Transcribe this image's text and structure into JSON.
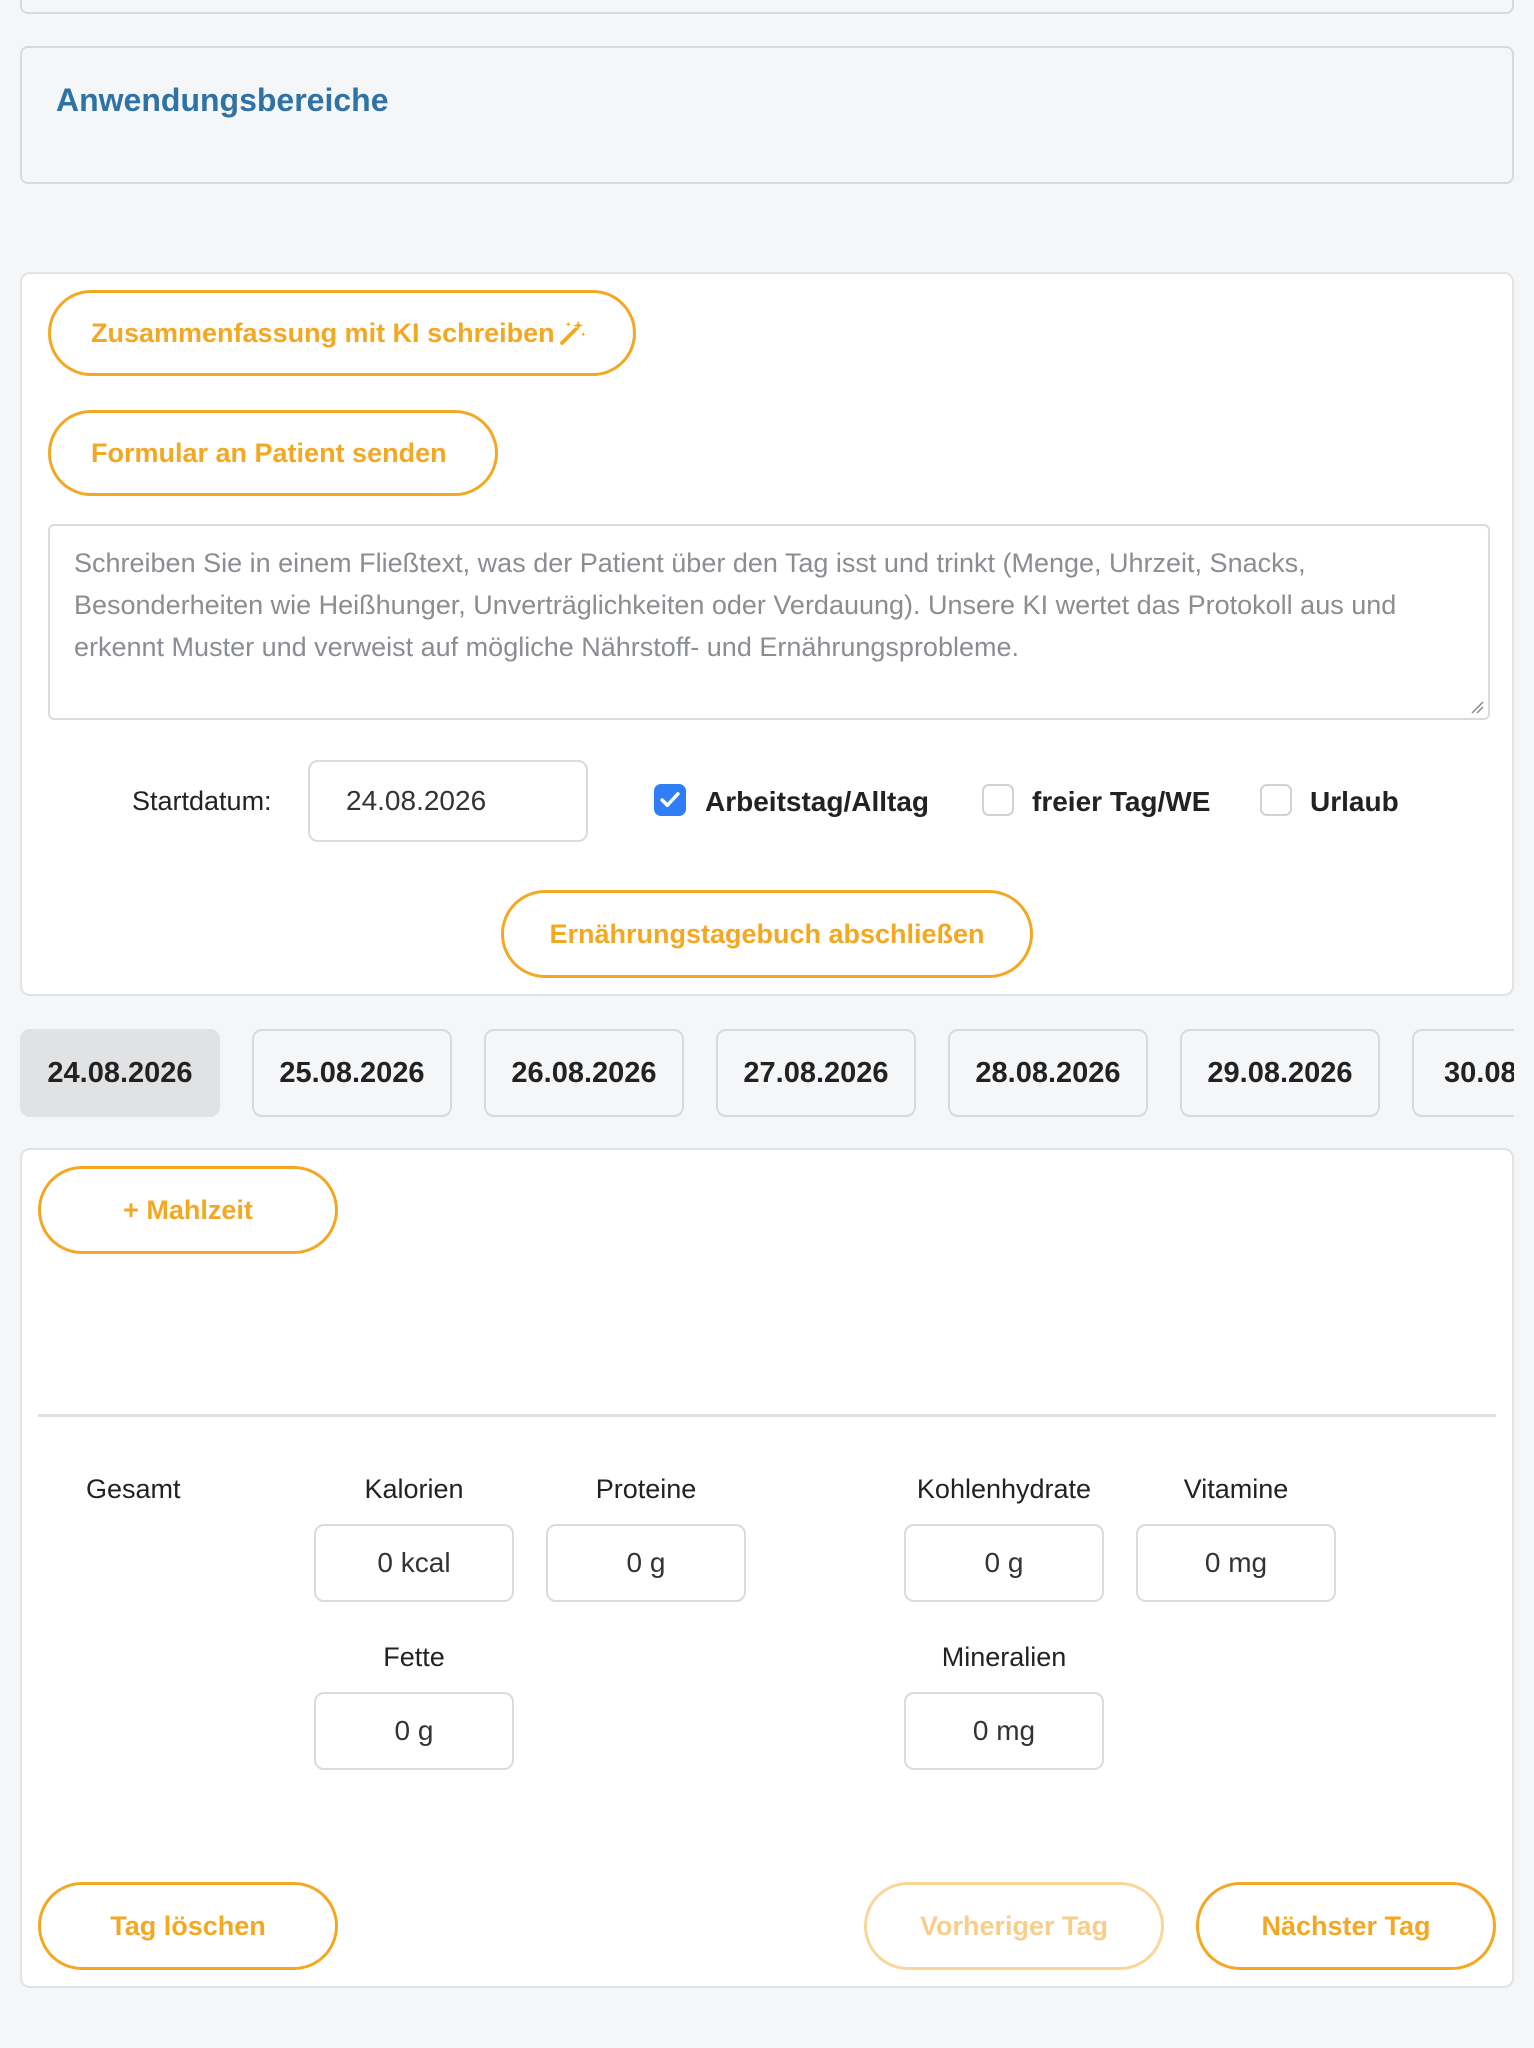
{
  "section": {
    "title": "Anwendungsbereiche"
  },
  "ai_card": {
    "summary_button": "Zusammenfassung mit KI schreiben",
    "send_form_button": "Formular an Patient senden",
    "protocol_placeholder": "Schreiben Sie in einem Fließtext, was der Patient über den Tag isst und trinkt (Menge, Uhrzeit, Snacks, Besonderheiten wie Heißhunger, Unverträglichkeiten oder Verdauung). Unsere KI wertet das Protokoll aus und erkennt Muster und verweist auf mögliche Nährstoff- und Ernährungsprobleme.",
    "start_label": "Startdatum:",
    "start_date": "24.08.2026",
    "day_types": [
      {
        "label": "Arbeitstag/Alltag",
        "checked": true
      },
      {
        "label": "freier Tag/WE",
        "checked": false
      },
      {
        "label": "Urlaub",
        "checked": false
      }
    ],
    "finish_button": "Ernährungstagebuch abschließen"
  },
  "date_tabs": [
    "24.08.2026",
    "25.08.2026",
    "26.08.2026",
    "27.08.2026",
    "28.08.2026",
    "29.08.2026",
    "30.08"
  ],
  "day_card": {
    "add_meal_button": "+ Mahlzeit",
    "totals_label": "Gesamt",
    "stats": {
      "calories": {
        "label": "Kalorien",
        "value": "0 kcal"
      },
      "proteins": {
        "label": "Proteine",
        "value": "0 g"
      },
      "carbs": {
        "label": "Kohlenhydrate",
        "value": "0 g"
      },
      "vitamins": {
        "label": "Vitamine",
        "value": "0 mg"
      },
      "fats": {
        "label": "Fette",
        "value": "0 g"
      },
      "minerals": {
        "label": "Mineralien",
        "value": "0 mg"
      }
    },
    "delete_day_button": "Tag löschen",
    "previous_day_button": "Vorheriger Tag",
    "next_day_button": "Nächster Tag"
  },
  "colors": {
    "accent": "#f3a823",
    "title_blue": "#2f72a5",
    "checkbox_blue": "#2f7ef5"
  }
}
